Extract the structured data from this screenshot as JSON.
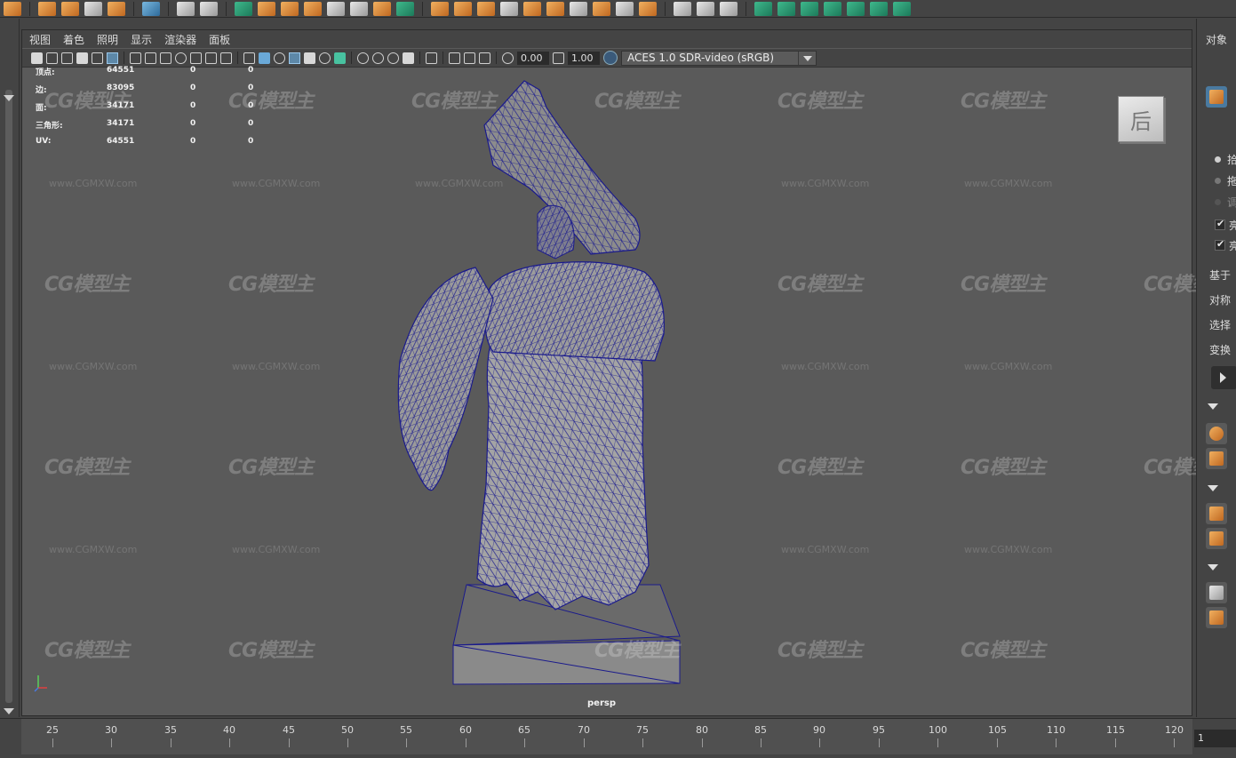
{
  "viewport_menu": [
    "视图",
    "着色",
    "照明",
    "显示",
    "渲染器",
    "面板"
  ],
  "toolbar": {
    "field_1": "0.00",
    "field_2": "1.00",
    "color_space": "ACES 1.0 SDR-video (sRGB)"
  },
  "hud": [
    {
      "label": "顶点:",
      "value": "64551",
      "sel": "0",
      "extra": "0"
    },
    {
      "label": "边:",
      "value": "83095",
      "sel": "0",
      "extra": "0"
    },
    {
      "label": "面:",
      "value": "34171",
      "sel": "0",
      "extra": "0"
    },
    {
      "label": "三角形:",
      "value": "34171",
      "sel": "0",
      "extra": "0"
    },
    {
      "label": "UV:",
      "value": "64551",
      "sel": "0",
      "extra": "0"
    }
  ],
  "viewcube_label": "后",
  "camera_label": "persp",
  "right_panel": {
    "title": "对象",
    "items": [
      "拾",
      "拖",
      "调",
      "亮",
      "亮",
      "基于",
      "对称",
      "选择",
      "变换"
    ]
  },
  "watermark": {
    "logo": "CG模型主",
    "url": "www.CGMXW.com"
  },
  "timeline": {
    "ticks": [
      "25",
      "30",
      "35",
      "40",
      "45",
      "50",
      "55",
      "60",
      "65",
      "70",
      "75",
      "80",
      "85",
      "90",
      "95",
      "100",
      "105",
      "110",
      "115",
      "120"
    ],
    "current_frame": "1"
  },
  "colors": {
    "wire": "#1a1a8c",
    "mesh": "#9a9a9a",
    "viewport_bg": "#5a5a5a",
    "accent_teal": "#48c2a0",
    "accent_orange": "#e89a40"
  }
}
